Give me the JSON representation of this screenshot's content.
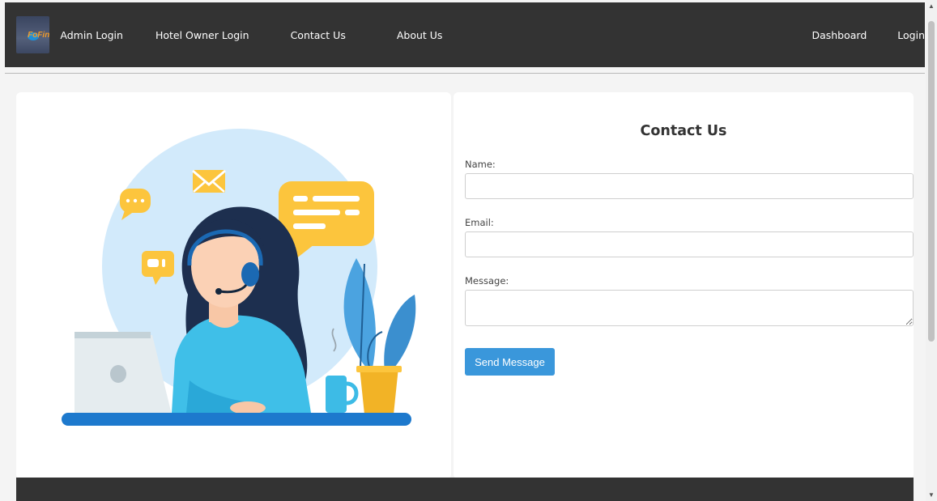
{
  "nav": {
    "logo_text": "FoFin",
    "links_left": [
      "Admin Login",
      "Hotel Owner Login",
      "Contact Us",
      "About Us"
    ],
    "links_right": [
      "Dashboard",
      "Login"
    ]
  },
  "form": {
    "title": "Contact Us",
    "name_label": "Name:",
    "name_value": "",
    "email_label": "Email:",
    "email_value": "",
    "message_label": "Message:",
    "message_value": "",
    "submit_label": "Send Message"
  },
  "colors": {
    "navbar": "#333333",
    "button": "#3a97db",
    "page_background": "#f4f4f4"
  },
  "icons": {
    "scroll_up": "▲",
    "scroll_down": "▼"
  }
}
